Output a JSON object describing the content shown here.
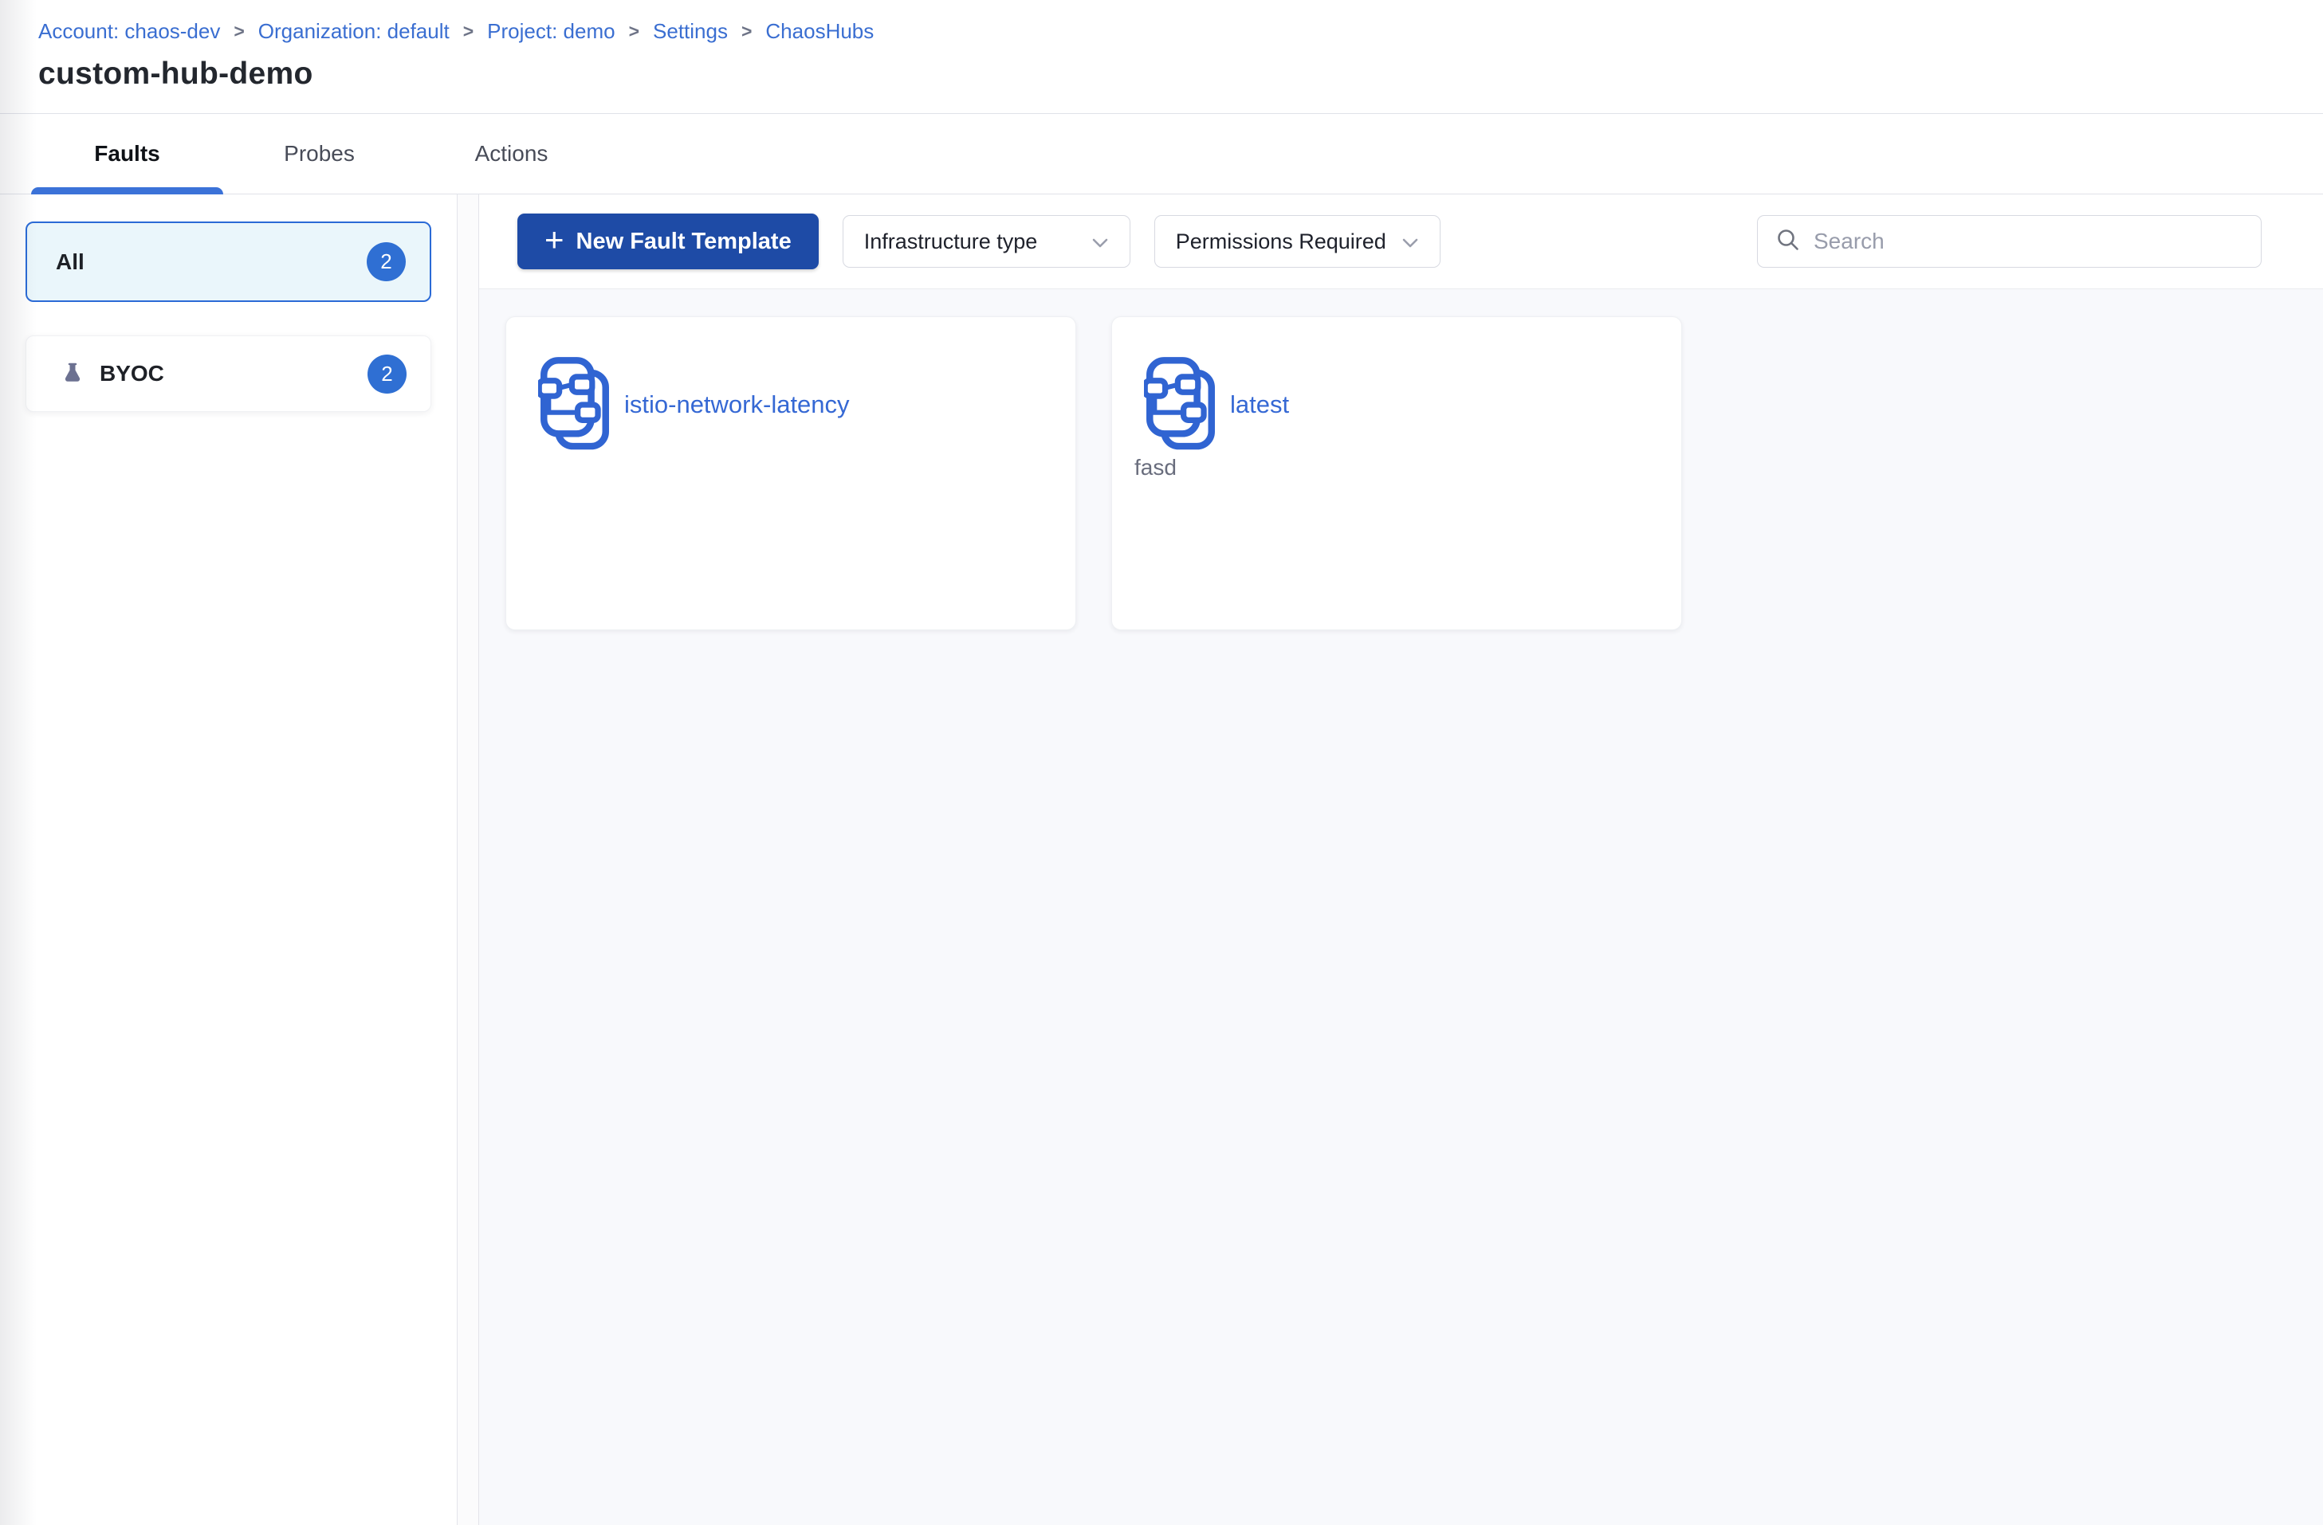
{
  "colors": {
    "link_blue": "#3a6ed1",
    "primary_button_bg": "#1e4ba6",
    "badge_bg": "#2f6fd3",
    "selected_card_bg": "#eaf6fb",
    "selected_card_border": "#2a6ad6",
    "tab_underline": "#3b72d8",
    "content_bg": "#f8f9fc",
    "icon_blue": "#3064d2",
    "flask_grey": "#6c7191"
  },
  "breadcrumb": {
    "separator": ">",
    "items": [
      "Account: chaos-dev",
      "Organization: default",
      "Project: demo",
      "Settings",
      "ChaosHubs"
    ]
  },
  "header": {
    "title": "custom-hub-demo"
  },
  "tabs": [
    {
      "label": "Faults",
      "active": true
    },
    {
      "label": "Probes",
      "active": false
    },
    {
      "label": "Actions",
      "active": false
    }
  ],
  "sidebar": {
    "items": [
      {
        "label": "All",
        "count": "2",
        "selected": true
      },
      {
        "label": "BYOC",
        "count": "2",
        "icon": "flask-icon"
      }
    ]
  },
  "toolbar": {
    "plus": "+",
    "new_fault_template_label": "New Fault Template",
    "filters": [
      {
        "label": "Infrastructure type"
      },
      {
        "label": "Permissions Required"
      }
    ],
    "search_placeholder": "Search"
  },
  "cards": [
    {
      "title": "istio-network-latency",
      "description": ""
    },
    {
      "title": "latest",
      "description": "fasd"
    }
  ]
}
